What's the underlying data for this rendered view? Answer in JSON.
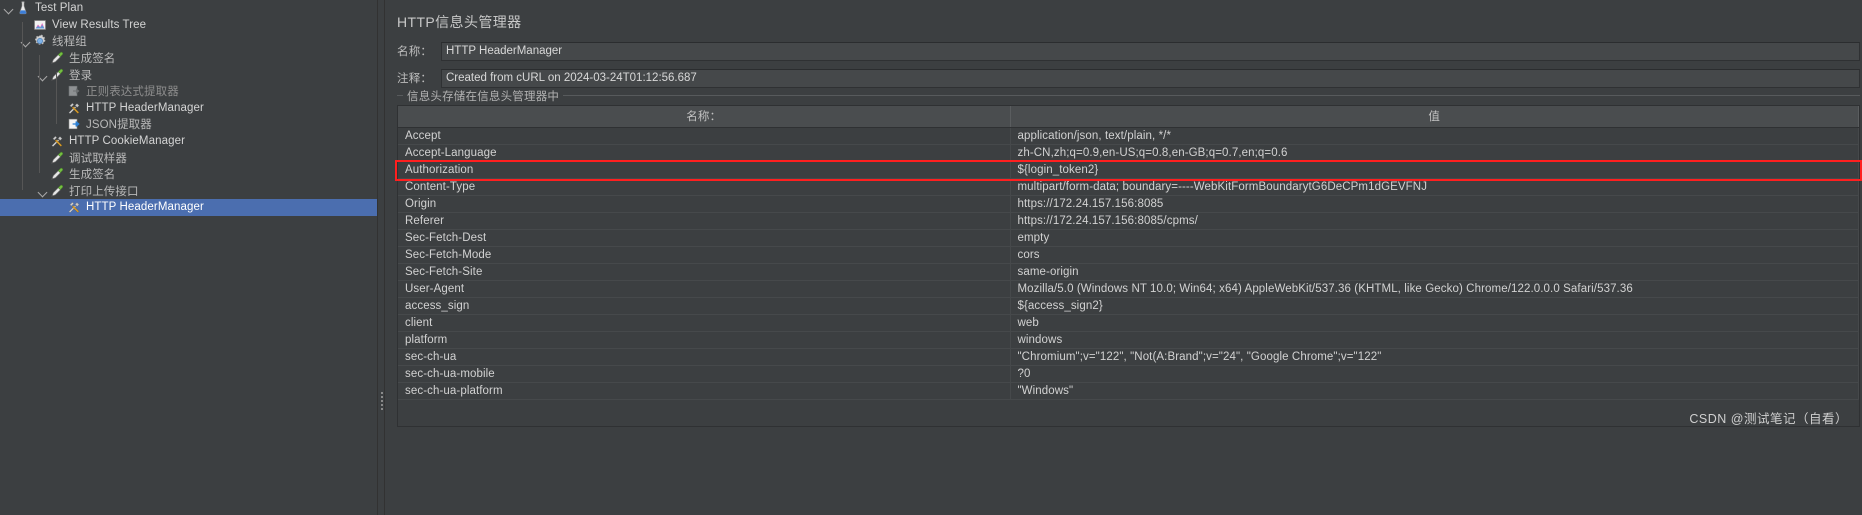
{
  "tree": {
    "nodes": [
      {
        "label": "Test Plan",
        "icon": "test-plan-icon",
        "depth": 0,
        "twisty": "open",
        "style": "en",
        "selected": false
      },
      {
        "label": "View Results Tree",
        "icon": "results-tree-icon",
        "depth": 1,
        "twisty": "none",
        "style": "en",
        "selected": false
      },
      {
        "label": "线程组",
        "icon": "thread-group-icon",
        "depth": 1,
        "twisty": "open",
        "style": "cn",
        "selected": false
      },
      {
        "label": "生成签名",
        "icon": "sampler-icon",
        "depth": 2,
        "twisty": "none",
        "style": "cn",
        "selected": false
      },
      {
        "label": "登录",
        "icon": "sampler-icon",
        "depth": 2,
        "twisty": "open",
        "style": "cn",
        "selected": false
      },
      {
        "label": "正则表达式提取器",
        "icon": "extractor-disabled-icon",
        "depth": 3,
        "twisty": "none",
        "style": "dim",
        "selected": false
      },
      {
        "label": "HTTP HeaderManager",
        "icon": "header-manager-icon",
        "depth": 3,
        "twisty": "none",
        "style": "en",
        "selected": false
      },
      {
        "label": "JSON提取器",
        "icon": "json-extractor-icon",
        "depth": 3,
        "twisty": "none",
        "style": "cn",
        "selected": false
      },
      {
        "label": "HTTP CookieManager",
        "icon": "cookie-manager-icon",
        "depth": 2,
        "twisty": "none",
        "style": "en",
        "selected": false
      },
      {
        "label": "调试取样器",
        "icon": "sampler-icon",
        "depth": 2,
        "twisty": "none",
        "style": "cn",
        "selected": false
      },
      {
        "label": "生成签名",
        "icon": "sampler-icon",
        "depth": 2,
        "twisty": "none",
        "style": "cn",
        "selected": false
      },
      {
        "label": "打印上传接口",
        "icon": "sampler-icon",
        "depth": 2,
        "twisty": "open",
        "style": "cn",
        "selected": false
      },
      {
        "label": "HTTP HeaderManager",
        "icon": "header-manager-icon",
        "depth": 3,
        "twisty": "none",
        "style": "en",
        "selected": true
      }
    ]
  },
  "panel": {
    "title": "HTTP信息头管理器",
    "name_label": "名称：",
    "name_value": "HTTP HeaderManager",
    "comment_label": "注释：",
    "comment_value": "Created from cURL on 2024-03-24T01:12:56.687",
    "group_legend": "信息头存储在信息头管理器中"
  },
  "table": {
    "columns": [
      "名称：",
      "值"
    ],
    "rows": [
      {
        "name": "Accept",
        "value": "application/json, text/plain, */*"
      },
      {
        "name": "Accept-Language",
        "value": "zh-CN,zh;q=0.9,en-US;q=0.8,en-GB;q=0.7,en;q=0.6"
      },
      {
        "name": "Authorization",
        "value": "${login_token2}"
      },
      {
        "name": "Content-Type",
        "value": "multipart/form-data; boundary=----WebKitFormBoundarytG6DeCPm1dGEVFNJ"
      },
      {
        "name": "Origin",
        "value": "https://172.24.157.156:8085"
      },
      {
        "name": "Referer",
        "value": "https://172.24.157.156:8085/cpms/"
      },
      {
        "name": "Sec-Fetch-Dest",
        "value": "empty"
      },
      {
        "name": "Sec-Fetch-Mode",
        "value": "cors"
      },
      {
        "name": "Sec-Fetch-Site",
        "value": "same-origin"
      },
      {
        "name": "User-Agent",
        "value": "Mozilla/5.0 (Windows NT 10.0; Win64; x64) AppleWebKit/537.36 (KHTML, like Gecko) Chrome/122.0.0.0 Safari/537.36"
      },
      {
        "name": "access_sign",
        "value": "${access_sign2}"
      },
      {
        "name": "client",
        "value": "web"
      },
      {
        "name": "platform",
        "value": "windows"
      },
      {
        "name": "sec-ch-ua",
        "value": "\"Chromium\";v=\"122\", \"Not(A:Brand\";v=\"24\", \"Google Chrome\";v=\"122\""
      },
      {
        "name": "sec-ch-ua-mobile",
        "value": "?0"
      },
      {
        "name": "sec-ch-ua-platform",
        "value": "\"Windows\""
      }
    ],
    "highlighted_row_index": 2
  },
  "watermark": {
    "text": "CSDN @测试笔记（自看）"
  },
  "colors": {
    "selection": "#4b6eaf",
    "highlight": "#ff1f1f",
    "panel_bg": "#3c3f41",
    "header_bg": "#4a4d4f"
  }
}
